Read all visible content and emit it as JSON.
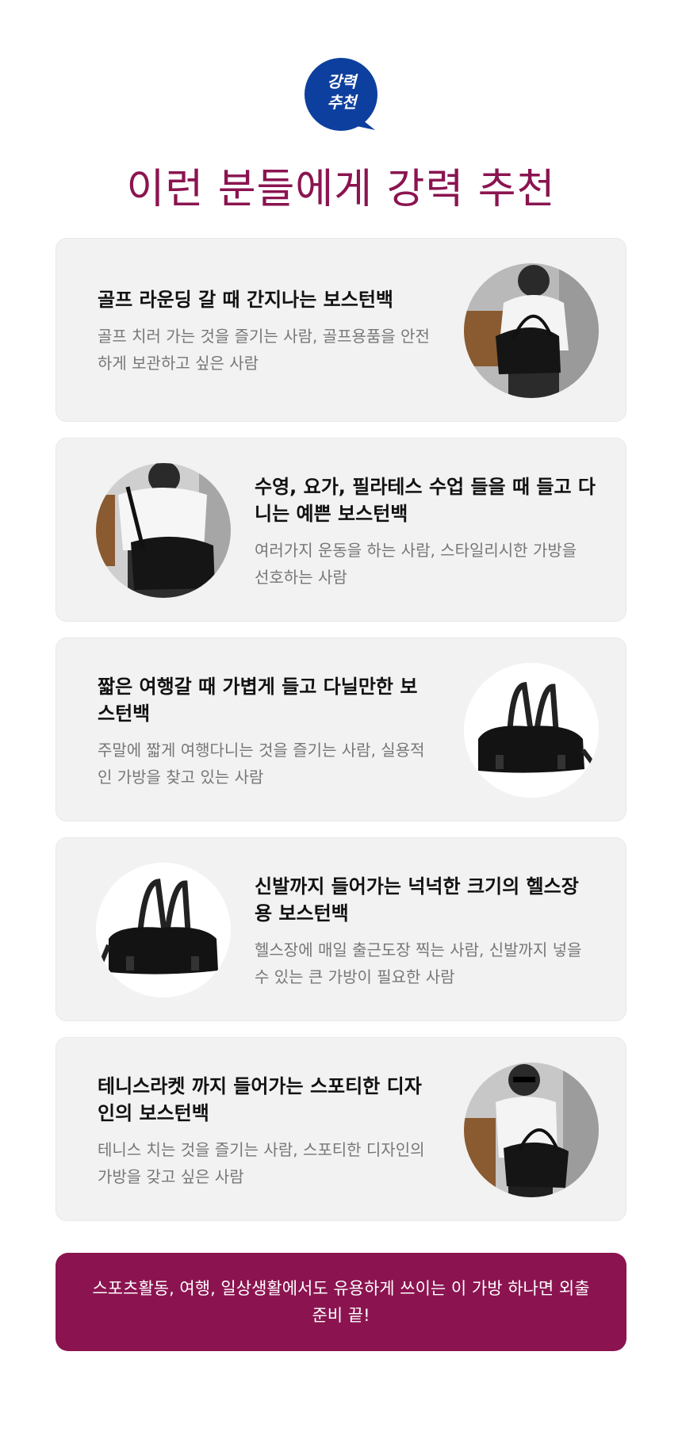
{
  "badge": {
    "line1": "강력",
    "line2": "추천"
  },
  "colors": {
    "brand": "#8b1450",
    "badge": "#0d3f9e",
    "card_bg": "#f2f2f2"
  },
  "headline": "이런 분들에게 강력 추천",
  "cards": [
    {
      "title": "골프 라운딩 갈 때 간지나는 보스턴백",
      "desc": "골프 치러 가는 것을 즐기는 사람, 골프용품을 안전하게 보관하고 싶은 사람",
      "image": "model-carrying-bag-photo"
    },
    {
      "title": "수영, 요가, 필라테스 수업 들을 때 들고 다니는 예쁜 보스턴백",
      "desc": "여러가지 운동을 하는 사람, 스타일리시한 가방을 선호하는 사람",
      "image": "model-back-shoulder-bag-photo"
    },
    {
      "title": "짧은 여행갈 때 가볍게 들고 다닐만한 보스턴백",
      "desc": "주말에 짧게 여행다니는 것을 즐기는 사람, 실용적인 가방을 찾고 있는 사람",
      "image": "black-boston-bag-photo"
    },
    {
      "title": "신발까지 들어가는 넉넉한 크기의 헬스장용 보스턴백",
      "desc": "헬스장에 매일 출근도장 찍는 사람, 신발까지 넣을 수 있는 큰 가방이 필요한 사람",
      "image": "black-boston-bag-photo"
    },
    {
      "title": "테니스라켓 까지 들어가는 스포티한 디자인의 보스턴백",
      "desc": "테니스 치는 것을 즐기는 사람, 스포티한 디자인의 가방을 갖고 싶은 사람",
      "image": "model-sunglasses-bag-photo"
    }
  ],
  "cta": "스포츠활동, 여행, 일상생활에서도 유용하게 쓰이는 이 가방 하나면 외출 준비 끝!"
}
